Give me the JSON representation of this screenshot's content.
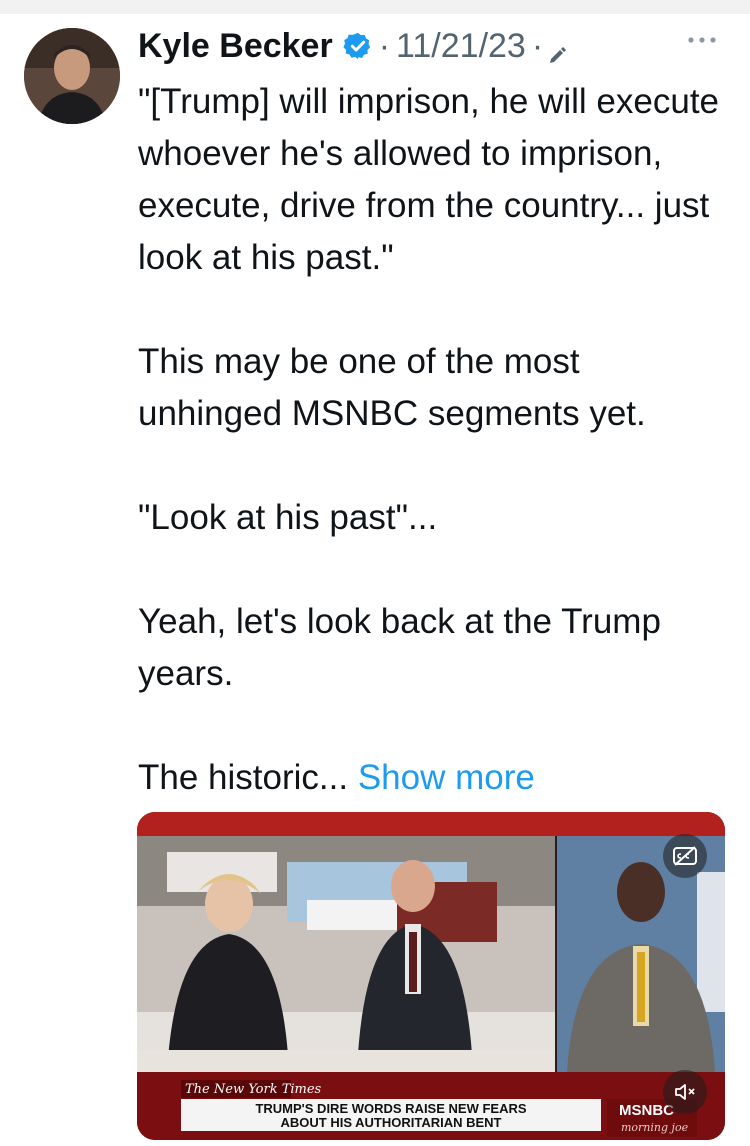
{
  "author": {
    "name": "Kyle Becker",
    "date": "11/21/23",
    "separator": "·"
  },
  "tweet": {
    "paragraphs": [
      "\"[Trump] will imprison, he will execute whoever he's allowed to imprison, execute, drive from the country... just look at his past.\"",
      "This may be one of the most unhinged MSNBC segments yet.",
      "\"Look at his past\"...",
      "Yeah, let's look back at the Trump years.",
      "The historic..."
    ],
    "show_more": "Show more"
  },
  "video": {
    "brand": "The New York Times",
    "headline_line1": "TRUMP'S DIRE WORDS RAISE NEW FEARS",
    "headline_line2": "ABOUT HIS AUTHORITARIAN BENT",
    "network": "MSNBC",
    "show": "morning joe"
  },
  "colors": {
    "link": "#1d9bf0",
    "verified": "#1d9bf0",
    "meta": "#536471"
  },
  "icons": [
    "verified-badge-icon",
    "edit-icon",
    "more-options-icon",
    "captions-icon",
    "mute-icon"
  ]
}
